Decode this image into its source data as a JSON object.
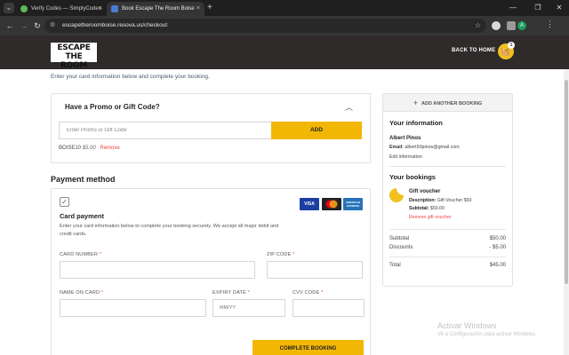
{
  "browser": {
    "tabs": [
      {
        "title": "Verify Codes — SimplyCodes",
        "active": false,
        "favicon_color": "#5fb85a"
      },
      {
        "title": "Book Escape The Room Boise",
        "active": true,
        "favicon_color": "#4a7bd0"
      }
    ],
    "tab_close": "×",
    "new_tab": "+",
    "url": "escapetheroomboise.resova.us/checkout",
    "profile_initial": "A",
    "window_controls": {
      "minimize": "—",
      "restore": "❐",
      "close": "✕"
    }
  },
  "header": {
    "logo": "ESCAPE THE ROOM",
    "back_home": "BACK TO HOME",
    "cart_count": "1"
  },
  "main": {
    "intro": "Enter your card information below and complete your booking.",
    "promo": {
      "title": "Have a Promo or Gift Code?",
      "placeholder": "Enter Promo or Gift Code",
      "add_label": "ADD",
      "applied_code": "BOISE10",
      "applied_amount": "$5.00",
      "remove_label": "Remove"
    },
    "payment": {
      "heading": "Payment method",
      "card_logos": [
        "VISA",
        "Mastercard",
        "AMERICAN EXPRESS"
      ],
      "card_title": "Card payment",
      "description": "Enter your card information below to complete your booking securely. We accept all major debit and credit cards.",
      "fields": {
        "card_number": "CARD NUMBER",
        "zip_code": "ZIP CODE",
        "name_on_card": "NAME ON CARD",
        "expiry_date": "EXPIRY DATE",
        "expiry_placeholder": "MM/YY",
        "cvv_code": "CVV CODE",
        "required_mark": "*"
      },
      "complete_label": "COMPLETE BOOKING"
    }
  },
  "sidebar": {
    "add_booking": "ADD ANOTHER BOOKING",
    "your_information": "Your information",
    "name": "Albert Pinos",
    "email_label": "Email:",
    "email": "albert50pinos@gmail.com",
    "edit_label": "Edit information",
    "your_bookings": "Your bookings",
    "item": {
      "title": "Gift voucher",
      "description_label": "Description:",
      "description": "Gift Voucher $50",
      "subtotal_label": "Subtotal:",
      "subtotal": "$50.00",
      "remove_label": "Remove gift voucher"
    },
    "totals": {
      "subtotal_label": "Subtotal",
      "subtotal": "$50.00",
      "discounts_label": "Discounts",
      "discounts": "- $5.00",
      "total_label": "Total",
      "total": "$45.00"
    }
  },
  "watermark": {
    "line1": "Activar Windows",
    "line2": "Ve a Configuración para activar Windows."
  }
}
